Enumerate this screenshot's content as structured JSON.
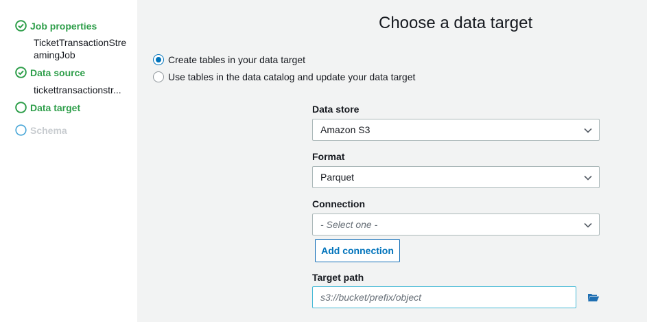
{
  "sidebar": {
    "steps": [
      {
        "label": "Job properties",
        "state": "done",
        "subtitle": "TicketTransactionStreamingJob"
      },
      {
        "label": "Data source",
        "state": "done",
        "subtitle": "tickettransactionstr..."
      },
      {
        "label": "Data target",
        "state": "current"
      },
      {
        "label": "Schema",
        "state": "todo"
      }
    ]
  },
  "main": {
    "title": "Choose a data target",
    "options": [
      {
        "label": "Create tables in your data target",
        "checked": true
      },
      {
        "label": "Use tables in the data catalog and update your data target",
        "checked": false
      }
    ],
    "data_store": {
      "label": "Data store",
      "value": "Amazon S3"
    },
    "format": {
      "label": "Format",
      "value": "Parquet"
    },
    "connection": {
      "label": "Connection",
      "placeholder": "- Select one -"
    },
    "add_connection_label": "Add connection",
    "target_path": {
      "label": "Target path",
      "placeholder": "s3://bucket/prefix/object",
      "value": ""
    }
  },
  "colors": {
    "success": "#2e9e4a",
    "pending": "#44a4d6",
    "accent": "#0073bb",
    "focus_border": "#44b9d6"
  },
  "icons": {
    "done": "check-circle-icon",
    "current": "empty-circle-icon",
    "todo": "empty-circle-icon",
    "select": "chevron-down-icon",
    "browse": "folder-open-icon"
  }
}
